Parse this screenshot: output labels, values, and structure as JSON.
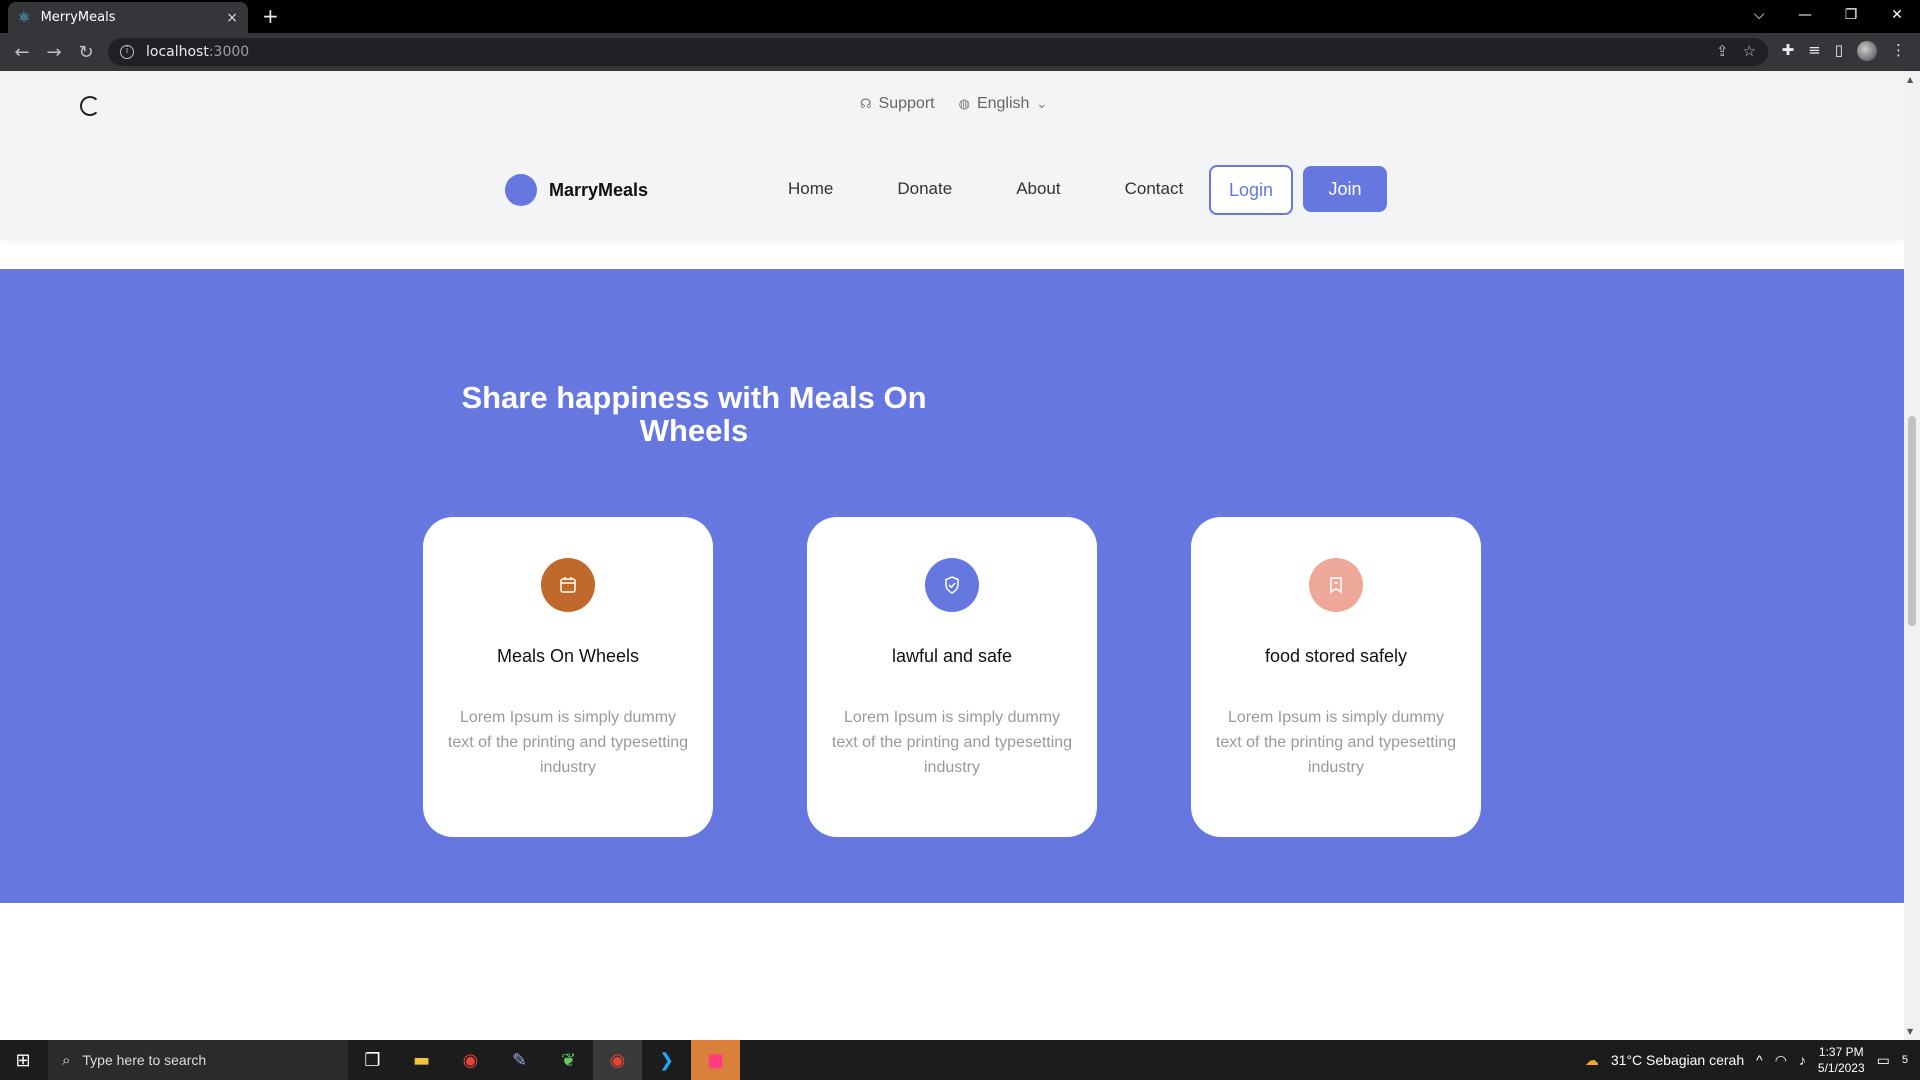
{
  "browser": {
    "tab_title": "MerryMeals",
    "tab_close": "×",
    "new_tab": "+",
    "url": "localhost",
    "url_port": ":3000",
    "window_controls": [
      "⌵",
      "—",
      "❐",
      "✕"
    ]
  },
  "header": {
    "support_label": "Support",
    "language_label": "English",
    "brand_name": "MarryMeals",
    "nav": [
      "Home",
      "Donate",
      "About",
      "Contact"
    ],
    "login_label": "Login",
    "join_label": "Join"
  },
  "hero": {
    "title": "Share happiness with Meals On Wheels",
    "cards": [
      {
        "title": "Meals On Wheels",
        "description": "Lorem Ipsum is simply dummy text of the printing and typesetting industry",
        "icon": "calendar-icon",
        "color": "#bf6a2c"
      },
      {
        "title": "lawful and safe",
        "description": "Lorem Ipsum is simply dummy text of the printing and typesetting industry",
        "icon": "shield-check-icon",
        "color": "#6678e0"
      },
      {
        "title": "food stored safely",
        "description": "Lorem Ipsum is simply dummy text of the printing and typesetting industry",
        "icon": "bookmark-icon",
        "color": "#eea89a"
      }
    ]
  },
  "taskbar": {
    "search_placeholder": "Type here to search",
    "weather": "31°C  Sebagian cerah",
    "time": "1:37 PM",
    "date": "5/1/2023",
    "notifications": "5"
  },
  "colors": {
    "accent": "#6678e0",
    "header_bg": "#f3f4f6"
  }
}
